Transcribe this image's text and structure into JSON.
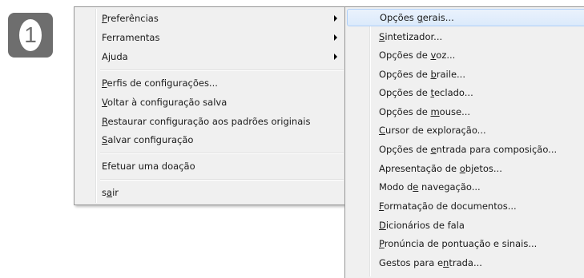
{
  "badge": {
    "number": "1"
  },
  "main_menu": {
    "items": [
      {
        "pre": "",
        "ul": "P",
        "post": "referências",
        "submenu": true
      },
      {
        "pre": "",
        "ul": "",
        "post": "Ferramentas",
        "submenu": true
      },
      {
        "pre": "",
        "ul": "",
        "post": "Ajuda",
        "submenu": true
      },
      {
        "pre": "",
        "ul": "P",
        "post": "erfis de configurações..."
      },
      {
        "pre": "",
        "ul": "V",
        "post": "oltar à configuração salva"
      },
      {
        "pre": "",
        "ul": "R",
        "post": "estaurar configuração aos padrões originais"
      },
      {
        "pre": "",
        "ul": "S",
        "post": "alvar configuração"
      },
      {
        "pre": "",
        "ul": "",
        "post": "Efetuar uma doação"
      },
      {
        "pre": "s",
        "ul": "a",
        "post": "ir"
      }
    ]
  },
  "sub_menu": {
    "items": [
      {
        "pre": "Opções ",
        "ul": "g",
        "post": "erais..."
      },
      {
        "pre": "",
        "ul": "S",
        "post": "intetizador..."
      },
      {
        "pre": "Opções de ",
        "ul": "v",
        "post": "oz..."
      },
      {
        "pre": "Opções de ",
        "ul": "b",
        "post": "raile..."
      },
      {
        "pre": "Opções de ",
        "ul": "t",
        "post": "eclado..."
      },
      {
        "pre": "Opções de ",
        "ul": "m",
        "post": "ouse..."
      },
      {
        "pre": "",
        "ul": "C",
        "post": "ursor de exploração..."
      },
      {
        "pre": "Opções de ",
        "ul": "e",
        "post": "ntrada para composição..."
      },
      {
        "pre": "Apresentação de ",
        "ul": "o",
        "post": "bjetos..."
      },
      {
        "pre": "Modo d",
        "ul": "e",
        "post": " navegação..."
      },
      {
        "pre": "",
        "ul": "F",
        "post": "ormatação de documentos..."
      },
      {
        "pre": "",
        "ul": "D",
        "post": "icionários de fala"
      },
      {
        "pre": "",
        "ul": "P",
        "post": "ronúncia de pontuação e sinais..."
      },
      {
        "pre": "Gestos para e",
        "ul": "n",
        "post": "trada..."
      }
    ]
  }
}
